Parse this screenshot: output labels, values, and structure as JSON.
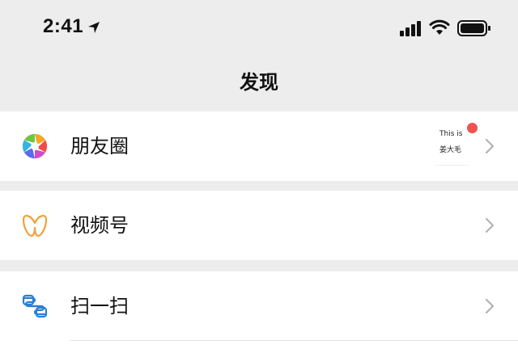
{
  "status_bar": {
    "time": "2:41",
    "icons": [
      "location-arrow-icon",
      "signal-icon",
      "wifi-icon",
      "battery-icon"
    ]
  },
  "header": {
    "title": "发现"
  },
  "rows": [
    {
      "label": "朋友圈",
      "icon": "moments-icon",
      "preview": {
        "line1": "This is",
        "line2": "姜大毛"
      },
      "has_red_dot": true
    },
    {
      "label": "视频号",
      "icon": "channels-icon"
    },
    {
      "label": "扫一扫",
      "icon": "scan-icon"
    }
  ],
  "colors": {
    "background": "#ededed",
    "row_background": "#ffffff",
    "red_dot": "#f15151",
    "channels_accent": "#f0a23c",
    "scan_accent": "#2a7fd6",
    "chevron": "#b2b2b2"
  }
}
